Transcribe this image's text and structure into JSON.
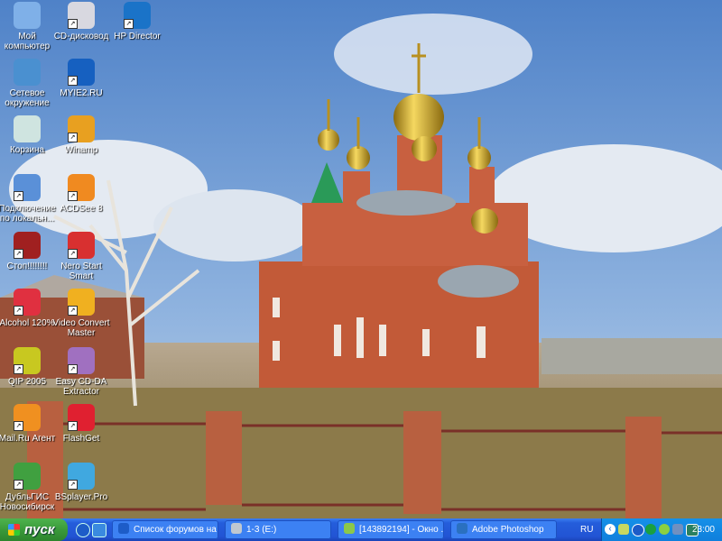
{
  "desktop": {
    "icons": [
      {
        "label": "Мой компьютер",
        "icon": "my-computer-icon",
        "color": "#7fb0e8"
      },
      {
        "label": "CD-дисковод",
        "icon": "cd-drive-icon",
        "color": "#d8d8e0"
      },
      {
        "label": "HP Director",
        "icon": "hp-director-icon",
        "color": "#1a73c8"
      },
      {
        "label": "Сетевое окружение",
        "icon": "network-icon",
        "color": "#4a90d0"
      },
      {
        "label": "MYIE2.RU",
        "icon": "myie2-icon",
        "color": "#1660c0"
      },
      {
        "label": "Корзина",
        "icon": "recycle-bin-icon",
        "color": "#cfe4e0"
      },
      {
        "label": "Winamp",
        "icon": "winamp-icon",
        "color": "#e8a020"
      },
      {
        "label": "Подключение по локальн...",
        "icon": "local-connection-icon",
        "color": "#5a90d8"
      },
      {
        "label": "ACDSee 8",
        "icon": "acdsee-icon",
        "color": "#f08a20"
      },
      {
        "label": "Cтоп!!!!!!!!",
        "icon": "stop-icon",
        "color": "#a02020"
      },
      {
        "label": "Nero Start Smart",
        "icon": "nero-icon",
        "color": "#d83030"
      },
      {
        "label": "Alcohol 120%",
        "icon": "alcohol-icon",
        "color": "#e03040"
      },
      {
        "label": "Video Convert Master",
        "icon": "video-convert-icon",
        "color": "#f0b020"
      },
      {
        "label": "QIP 2005",
        "icon": "qip-icon",
        "color": "#c8c820"
      },
      {
        "label": "Easy CD-DA Extractor",
        "icon": "cd-extractor-icon",
        "color": "#a070c0"
      },
      {
        "label": "Mail.Ru Агент",
        "icon": "mailru-agent-icon",
        "color": "#f09020"
      },
      {
        "label": "FlashGet",
        "icon": "flashget-icon",
        "color": "#e02030"
      },
      {
        "label": "ДубльГИС Новосибирск",
        "icon": "2gis-icon",
        "color": "#40a040"
      },
      {
        "label": "BSplayer.Pro",
        "icon": "bsplayer-icon",
        "color": "#40a8e0"
      }
    ]
  },
  "taskbar": {
    "start_label": "пуск",
    "tasks": [
      {
        "label": "Список форумов на ...",
        "color": "#1d5cc8"
      },
      {
        "label": "1-3 (E:)",
        "color": "#c0c8d0"
      },
      {
        "label": "[143892194] - Окно ...",
        "color": "#8cc84a"
      },
      {
        "label": "Adobe Photoshop",
        "color": "#2a70c0"
      }
    ],
    "language": "RU",
    "clock": "23:00"
  }
}
